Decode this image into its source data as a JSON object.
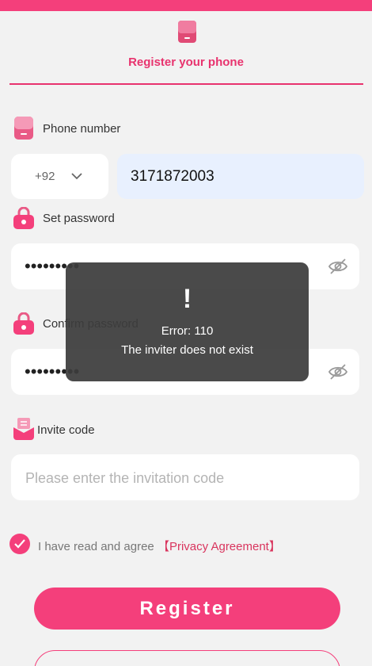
{
  "header": {
    "title": "Register your phone"
  },
  "phone": {
    "label": "Phone number",
    "country_code": "+92",
    "value": "3171872003"
  },
  "password": {
    "label": "Set password",
    "masked_value": "•••••••••"
  },
  "confirm_password": {
    "label": "Confirm password",
    "masked_value": "•••••••••"
  },
  "invite": {
    "label": "Invite code",
    "placeholder": "Please enter the invitation code"
  },
  "agreement": {
    "text": "I have read and agree",
    "link": "【Privacy Agreement】",
    "checked": true
  },
  "register_button": {
    "label": "Register"
  },
  "toast": {
    "icon": "!",
    "code": "Error: 110",
    "message": "The inviter does not exist"
  },
  "colors": {
    "accent": "#f43f7b",
    "link": "#d9355e",
    "toast_bg": "#3c3c3c"
  },
  "icons": [
    "phone-icon",
    "lock-icon",
    "invite-icon",
    "chevron-down-icon",
    "eye-off-icon",
    "check-icon"
  ]
}
